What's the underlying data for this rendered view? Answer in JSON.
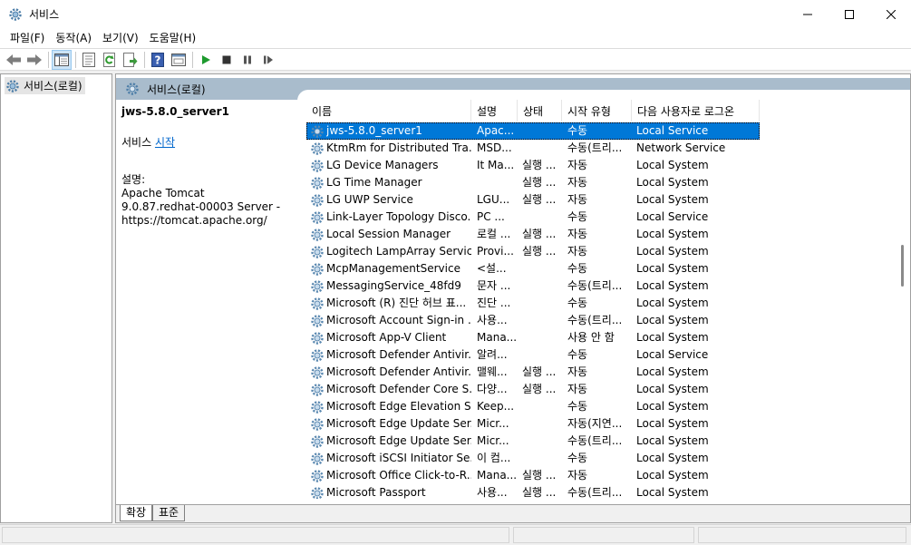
{
  "window": {
    "title": "서비스"
  },
  "menu": [
    "파일(F)",
    "동작(A)",
    "보기(V)",
    "도움말(H)"
  ],
  "toolbar": {
    "buttons": [
      "back-icon",
      "forward-icon",
      "show-hide-tree-icon",
      "properties-icon",
      "refresh-icon",
      "export-list-icon",
      "help-icon",
      "view-icon",
      "start-service-icon",
      "stop-service-icon",
      "pause-service-icon",
      "restart-service-icon"
    ]
  },
  "tree": {
    "root_label": "서비스(로컬)"
  },
  "content": {
    "header_label": "서비스(로컬)",
    "selected_service_name": "jws-5.8.0_server1",
    "action_prefix": "서비스",
    "action_link": "시작",
    "description_label": "설명:",
    "description_text": "Apache Tomcat 9.0.87.redhat-00003 Server - https://tomcat.apache.org/"
  },
  "columns": [
    "이름",
    "설명",
    "상태",
    "시작 유형",
    "다음 사용자로 로그온"
  ],
  "services": [
    {
      "name": "jws-5.8.0_server1",
      "desc": "Apac...",
      "status": "",
      "start": "수동",
      "logon": "Local Service",
      "selected": true
    },
    {
      "name": "KtmRm for Distributed Tra...",
      "desc": "MSD...",
      "status": "",
      "start": "수동(트리...",
      "logon": "Network Service"
    },
    {
      "name": "LG Device Managers",
      "desc": "It Ma...",
      "status": "실행 ...",
      "start": "자동",
      "logon": "Local System"
    },
    {
      "name": "LG Time Manager",
      "desc": "",
      "status": "실행 ...",
      "start": "자동",
      "logon": "Local System"
    },
    {
      "name": "LG UWP Service",
      "desc": "LGU...",
      "status": "실행 ...",
      "start": "자동",
      "logon": "Local System"
    },
    {
      "name": "Link-Layer Topology Disco...",
      "desc": "PC ...",
      "status": "",
      "start": "수동",
      "logon": "Local Service"
    },
    {
      "name": "Local Session Manager",
      "desc": "로컬 ...",
      "status": "실행 ...",
      "start": "자동",
      "logon": "Local System"
    },
    {
      "name": "Logitech LampArray Service",
      "desc": "Provi...",
      "status": "실행 ...",
      "start": "자동",
      "logon": "Local System"
    },
    {
      "name": "McpManagementService",
      "desc": "<설...",
      "status": "",
      "start": "수동",
      "logon": "Local System"
    },
    {
      "name": "MessagingService_48fd9",
      "desc": "문자 ...",
      "status": "",
      "start": "수동(트리...",
      "logon": "Local System"
    },
    {
      "name": "Microsoft (R) 진단 허브 표...",
      "desc": "진단 ...",
      "status": "",
      "start": "수동",
      "logon": "Local System"
    },
    {
      "name": "Microsoft Account Sign-in ...",
      "desc": "사용...",
      "status": "",
      "start": "수동(트리...",
      "logon": "Local System"
    },
    {
      "name": "Microsoft App-V Client",
      "desc": "Mana...",
      "status": "",
      "start": "사용 안 함",
      "logon": "Local System"
    },
    {
      "name": "Microsoft Defender Antivir...",
      "desc": "알려...",
      "status": "",
      "start": "수동",
      "logon": "Local Service"
    },
    {
      "name": "Microsoft Defender Antivir...",
      "desc": "맬웨...",
      "status": "실행 ...",
      "start": "자동",
      "logon": "Local System"
    },
    {
      "name": "Microsoft Defender Core S...",
      "desc": "다양...",
      "status": "실행 ...",
      "start": "자동",
      "logon": "Local System"
    },
    {
      "name": "Microsoft Edge Elevation S...",
      "desc": "Keep...",
      "status": "",
      "start": "수동",
      "logon": "Local System"
    },
    {
      "name": "Microsoft Edge Update Ser...",
      "desc": "Micr...",
      "status": "",
      "start": "자동(지연...",
      "logon": "Local System"
    },
    {
      "name": "Microsoft Edge Update Ser...",
      "desc": "Micr...",
      "status": "",
      "start": "수동(트리...",
      "logon": "Local System"
    },
    {
      "name": "Microsoft iSCSI Initiator Se...",
      "desc": "이 컴...",
      "status": "",
      "start": "수동",
      "logon": "Local System"
    },
    {
      "name": "Microsoft Office Click-to-R...",
      "desc": "Mana...",
      "status": "실행 ...",
      "start": "자동",
      "logon": "Local System"
    },
    {
      "name": "Microsoft Passport",
      "desc": "사용...",
      "status": "실행 ...",
      "start": "수동(트리...",
      "logon": "Local System"
    }
  ],
  "tabs": [
    "확장",
    "표준"
  ]
}
